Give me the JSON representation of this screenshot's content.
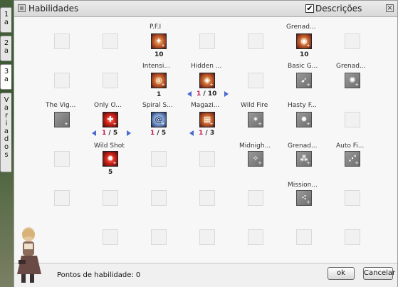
{
  "tabs": [
    {
      "label": "1a"
    },
    {
      "label": "2a"
    },
    {
      "label": "3a"
    },
    {
      "label": "Variados"
    }
  ],
  "window": {
    "title": "Habilidades",
    "descriptions_label": "Descrições",
    "descriptions_checked": true
  },
  "skills": [
    {
      "id": "pfi",
      "label": "P.F.I",
      "level": "10",
      "state": "active",
      "icon": "pfi-icon"
    },
    {
      "id": "grenade-top",
      "label": "Grenad...",
      "level": "10",
      "state": "active",
      "icon": "grenade-icon"
    },
    {
      "id": "intensive",
      "label": "Intensi...",
      "level": "1",
      "state": "active",
      "icon": "intensive-aim-icon"
    },
    {
      "id": "hidden",
      "label": "Hidden ...",
      "cur": "1",
      "max": "10",
      "state": "active",
      "icon": "hidden-card-icon"
    },
    {
      "id": "basic-g",
      "label": "Basic G...",
      "state": "locked",
      "icon": "basic-grenade-icon"
    },
    {
      "id": "grenade-r2",
      "label": "Grenad...",
      "state": "locked",
      "icon": "grenade-fragment-icon"
    },
    {
      "id": "vigilante",
      "label": "The Vig...",
      "state": "locked",
      "icon": "vigilante-icon"
    },
    {
      "id": "only-one",
      "label": "Only O...",
      "cur": "1",
      "max": "5",
      "state": "active",
      "icon": "only-one-bullet-icon"
    },
    {
      "id": "spiral",
      "label": "Spiral S...",
      "cur": "1",
      "max": "5",
      "state": "active",
      "icon": "spiral-shooting-icon"
    },
    {
      "id": "magazine",
      "label": "Magazi...",
      "cur": "1",
      "max": "3",
      "state": "active",
      "icon": "magazine-icon"
    },
    {
      "id": "wild-fire",
      "label": "Wild Fire",
      "state": "locked",
      "icon": "wild-fire-icon"
    },
    {
      "id": "hasty",
      "label": "Hasty F...",
      "state": "locked",
      "icon": "hasty-fire-icon"
    },
    {
      "id": "wild-shot",
      "label": "Wild Shot",
      "level": "5",
      "state": "active",
      "icon": "wild-shot-icon"
    },
    {
      "id": "midnight",
      "label": "Midnigh...",
      "state": "locked",
      "icon": "midnight-fallen-icon"
    },
    {
      "id": "grenade-r4",
      "label": "Grenad...",
      "state": "locked",
      "icon": "grenade-dropping-icon"
    },
    {
      "id": "auto-fi",
      "label": "Auto Fi...",
      "state": "locked",
      "icon": "auto-firing-icon"
    },
    {
      "id": "mission",
      "label": "Mission...",
      "state": "locked",
      "icon": "mission-bombard-icon"
    }
  ],
  "footer": {
    "points_label": "Pontos de habilidade: 0",
    "ok_label": "ok",
    "cancel_label": "Cancelar"
  }
}
